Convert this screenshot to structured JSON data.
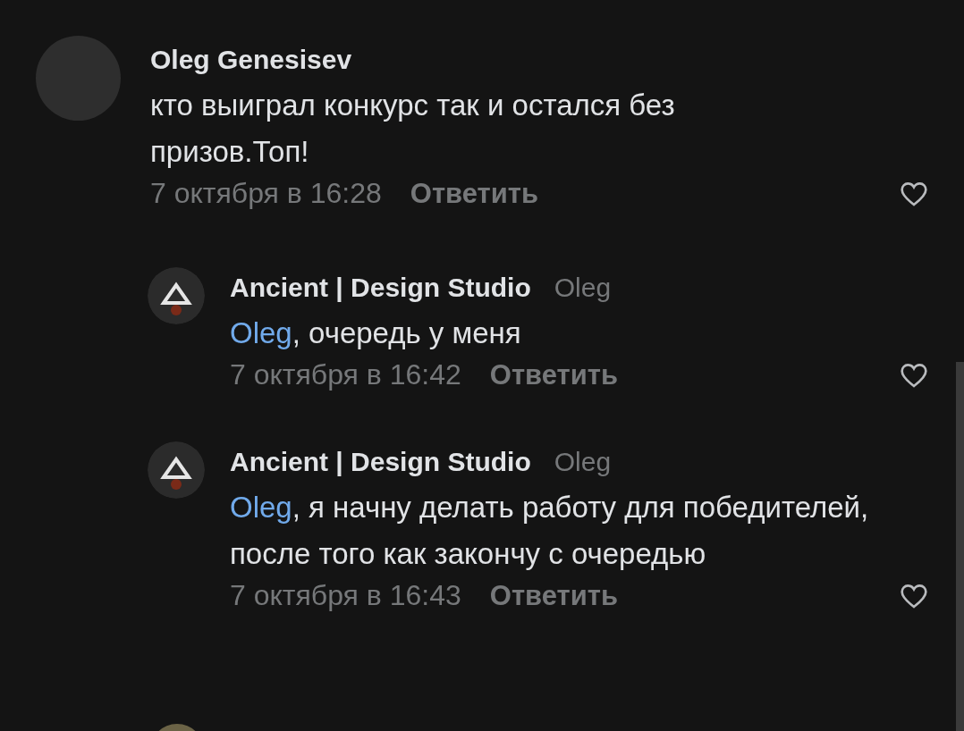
{
  "comments": [
    {
      "author": "Oleg Genesisev",
      "text": "кто выиграл конкурс так и остался без призов.Топ!",
      "date": "7 октября в 16:28",
      "reply_label": "Ответить",
      "replies": [
        {
          "author": "Ancient | Design Studio",
          "reply_to": "Oleg",
          "mention": "Oleg",
          "text": ", очередь у меня",
          "date": "7 октября в 16:42",
          "reply_label": "Ответить"
        },
        {
          "author": "Ancient | Design Studio",
          "reply_to": "Oleg",
          "mention": "Oleg",
          "text": ", я начну делать работу для победителей, после того как закончу с очередью",
          "date": "7 октября в 16:43",
          "reply_label": "Ответить"
        }
      ]
    }
  ]
}
